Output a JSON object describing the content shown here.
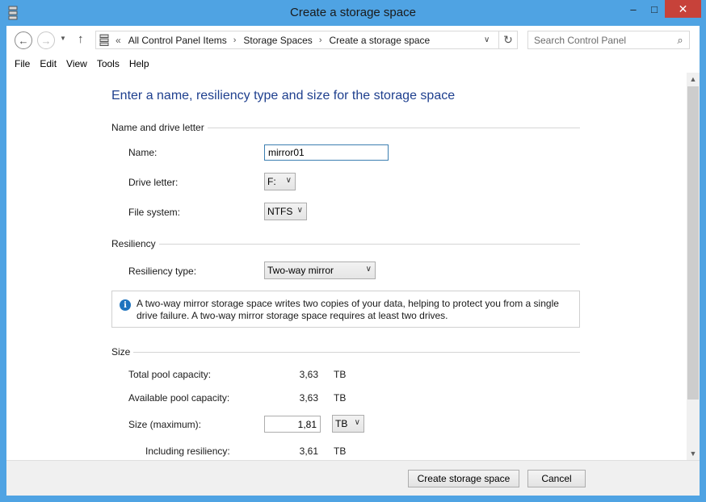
{
  "window": {
    "title": "Create a storage space",
    "controls": {
      "minimize": "–",
      "maximize": "□",
      "close": "✕"
    }
  },
  "nav": {
    "back_icon": "←",
    "forward_icon": "→",
    "recent_icon": "▼",
    "up_icon": "↑"
  },
  "address": {
    "overflow": "«",
    "crumbs": [
      "All Control Panel Items",
      "Storage Spaces",
      "Create a storage space"
    ],
    "separator": "›",
    "dropdown_icon": "∨",
    "refresh_icon": "↻"
  },
  "search": {
    "placeholder": "Search Control Panel",
    "icon": "⌕"
  },
  "menu": [
    "File",
    "Edit",
    "View",
    "Tools",
    "Help"
  ],
  "page": {
    "heading": "Enter a name, resiliency type and size for the storage space",
    "sections": {
      "name_drive": "Name and drive letter",
      "resiliency": "Resiliency",
      "size": "Size"
    },
    "fields": {
      "name_label": "Name:",
      "name_value": "mirror01",
      "drive_label": "Drive letter:",
      "drive_value": "F:",
      "fs_label": "File system:",
      "fs_value": "NTFS",
      "resiliency_label": "Resiliency type:",
      "resiliency_value": "Two-way mirror"
    },
    "info": {
      "icon": "i",
      "text": "A two-way mirror storage space writes two copies of your data, helping to protect you from a single drive failure. A two-way mirror storage space requires at least two drives."
    },
    "size": {
      "total_label": "Total pool capacity:",
      "total_value": "3,63",
      "total_unit": "TB",
      "available_label": "Available pool capacity:",
      "available_value": "3,63",
      "available_unit": "TB",
      "max_label": "Size (maximum):",
      "max_value": "1,81",
      "max_unit": "TB",
      "incl_label": "Including resiliency:",
      "incl_value": "3,61",
      "incl_unit": "TB"
    }
  },
  "scrollbar": {
    "up": "▲",
    "down": "▼"
  },
  "buttons": {
    "create": "Create storage space",
    "cancel": "Cancel"
  }
}
